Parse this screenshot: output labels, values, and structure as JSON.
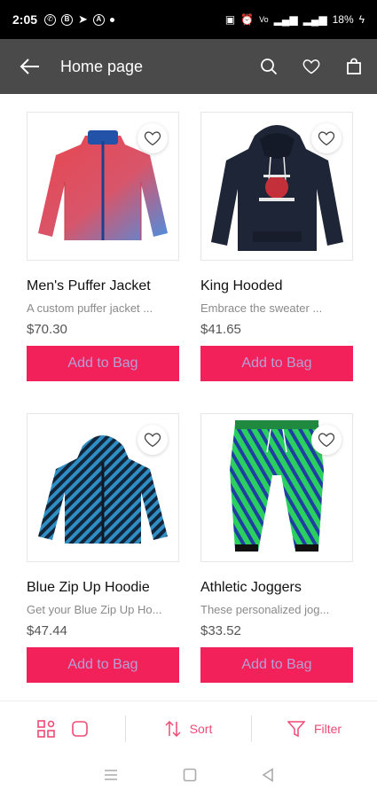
{
  "status_bar": {
    "time": "2:05",
    "battery": "18%",
    "colors": {
      "background": "#000000",
      "text": "#ffffff"
    }
  },
  "app_bar": {
    "title": "Home page",
    "background": "#4a4a4a",
    "icons": [
      "back-arrow-icon",
      "search-icon",
      "heart-icon",
      "shopping-bag-icon"
    ]
  },
  "products": [
    {
      "name": "Men's Puffer Jacket",
      "description": "A custom puffer jacket ...",
      "price": "$70.30",
      "button_label": "Add to Bag",
      "image": "puffer-jacket"
    },
    {
      "name": "King Hooded",
      "description": "Embrace the sweater ...",
      "price": "$41.65",
      "button_label": "Add to Bag",
      "image": "black-hoodie"
    },
    {
      "name": "Blue Zip Up Hoodie",
      "description": "Get your Blue Zip Up Ho...",
      "price": "$47.44",
      "button_label": "Add to Bag",
      "image": "striped-hoodie"
    },
    {
      "name": "Athletic Joggers",
      "description": "These personalized jog...",
      "price": "$33.52",
      "button_label": "Add to Bag",
      "image": "green-joggers"
    }
  ],
  "bottom_bar": {
    "sort_label": "Sort",
    "filter_label": "Filter",
    "accent": "#ef4a75"
  },
  "theme": {
    "button_bg": "#f2215a",
    "button_text": "#b6a0d6"
  }
}
